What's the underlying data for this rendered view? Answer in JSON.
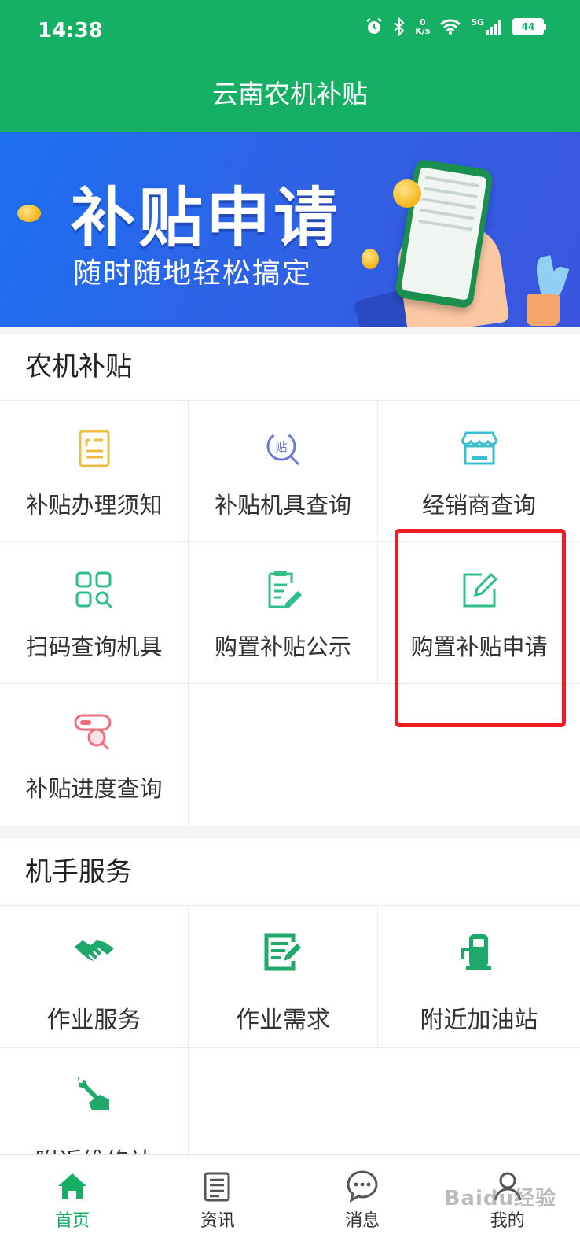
{
  "status_bar": {
    "time": "14:38",
    "net_speed_value": "0",
    "net_speed_unit": "K/s",
    "signal": "5G",
    "battery": "44"
  },
  "app": {
    "title": "云南农机补贴"
  },
  "banner": {
    "title": "补贴申请",
    "subtitle": "随时随地轻松搞定"
  },
  "subsidy_section": {
    "title": "农机补贴",
    "items": [
      {
        "label": "补贴办理须知",
        "icon": "document-list-icon",
        "color": "#f1bb41"
      },
      {
        "label": "补贴机具查询",
        "icon": "subsidy-search-icon",
        "color": "#6c78d8"
      },
      {
        "label": "经销商查询",
        "icon": "store-icon",
        "color": "#3dbdd0"
      },
      {
        "label": "扫码查询机具",
        "icon": "scan-grid-icon",
        "color": "#2fbf86"
      },
      {
        "label": "购置补贴公示",
        "icon": "clipboard-edit-icon",
        "color": "#2fbf86"
      },
      {
        "label": "购置补贴申请",
        "icon": "edit-square-icon",
        "color": "#2fbf86"
      },
      {
        "label": "补贴进度查询",
        "icon": "progress-search-icon",
        "color": "#ef6e7e"
      }
    ]
  },
  "operator_section": {
    "title": "机手服务",
    "items": [
      {
        "label": "作业服务",
        "icon": "handshake-icon",
        "color": "#1ea86a"
      },
      {
        "label": "作业需求",
        "icon": "form-edit-icon",
        "color": "#1ea86a"
      },
      {
        "label": "附近加油站",
        "icon": "fuel-pump-icon",
        "color": "#1ea86a"
      },
      {
        "label": "附近维修站",
        "icon": "wrench-hand-icon",
        "color": "#1ea86a"
      }
    ]
  },
  "tabbar": {
    "tabs": [
      {
        "label": "首页",
        "icon": "home-icon",
        "active": true
      },
      {
        "label": "资讯",
        "icon": "news-icon",
        "active": false
      },
      {
        "label": "消息",
        "icon": "message-icon",
        "active": false
      },
      {
        "label": "我的",
        "icon": "profile-icon",
        "active": false
      }
    ]
  },
  "watermark": "Baidu经验",
  "colors": {
    "primary": "#16b065",
    "highlight": "#ee1d23"
  }
}
